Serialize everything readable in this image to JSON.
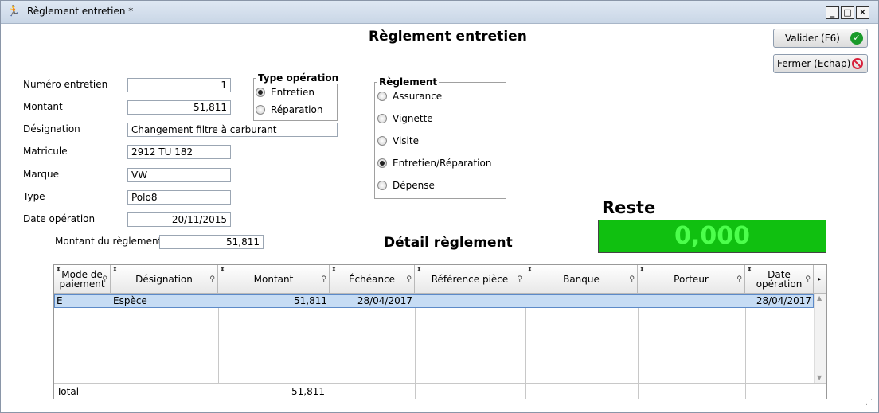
{
  "window": {
    "title": "Règlement entretien *",
    "icon": "runner-icon",
    "controls": {
      "minimize": "_",
      "maximize": "□",
      "close": "✕"
    }
  },
  "form": {
    "heading": "Règlement entretien",
    "fields": {
      "numero_label": "Numéro entretien",
      "numero_value": "1",
      "montant_label": "Montant",
      "montant_value": "51,811",
      "designation_label": "Désignation",
      "designation_value": "Changement filtre à carburant",
      "matricule_label": "Matricule",
      "matricule_value": "2912 TU 182",
      "marque_label": "Marque",
      "marque_value": "VW",
      "type_label": "Type",
      "type_value": "Polo8",
      "date_label": "Date opération",
      "date_value": "20/11/2015",
      "montant_reglement_label": "Montant du règlement",
      "montant_reglement_value": "51,811"
    },
    "type_operation": {
      "title": "Type opération",
      "options": [
        {
          "label": "Entretien",
          "selected": true
        },
        {
          "label": "Réparation",
          "selected": false
        }
      ]
    },
    "reglement": {
      "title": "Règlement",
      "options": [
        {
          "label": "Assurance",
          "selected": false
        },
        {
          "label": "Vignette",
          "selected": false
        },
        {
          "label": "Visite",
          "selected": false
        },
        {
          "label": "Entretien/Réparation",
          "selected": true
        },
        {
          "label": "Dépense",
          "selected": false
        }
      ]
    }
  },
  "buttons": {
    "valider_label": "Valider (F6)",
    "fermer_label": "Fermer (Echap)"
  },
  "reste": {
    "label": "Reste",
    "value": "0,000",
    "bg_color": "#10c010",
    "text_color": "#4cff4c"
  },
  "detail": {
    "title": "Détail règlement",
    "columns": [
      "Mode de paiement",
      "Désignation",
      "Montant",
      "Échéance",
      "Référence pièce",
      "Banque",
      "Porteur",
      "Date opération"
    ],
    "rows": [
      {
        "mode": "E",
        "designation": "Espèce",
        "montant": "51,811",
        "echeance": "28/04/2017",
        "reference": "",
        "banque": "",
        "porteur": "",
        "date": "28/04/2017"
      }
    ],
    "footer": {
      "label": "Total",
      "montant": "51,811"
    }
  }
}
